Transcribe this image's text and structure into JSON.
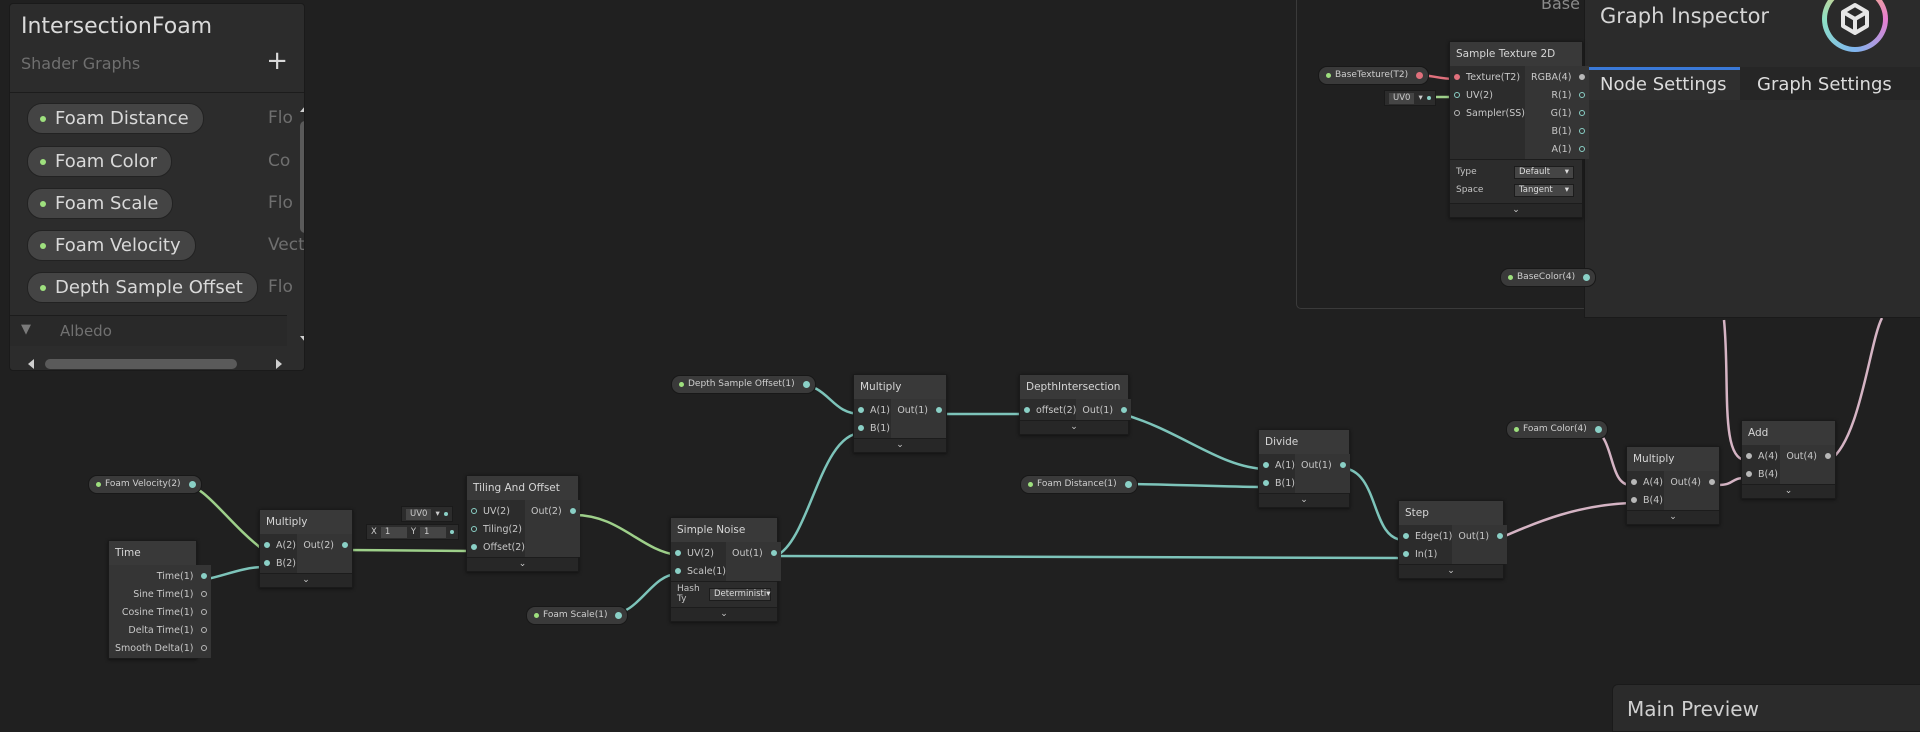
{
  "blackboard": {
    "title": "IntersectionFoam",
    "subtitle": "Shader Graphs",
    "add_label": "+",
    "properties": [
      {
        "name": "Foam Distance",
        "type": "Flo"
      },
      {
        "name": "Foam Color",
        "type": "Co"
      },
      {
        "name": "Foam Scale",
        "type": "Flo"
      },
      {
        "name": "Foam Velocity",
        "type": "Vecto"
      },
      {
        "name": "Depth Sample Offset",
        "type": "Flo"
      }
    ],
    "category": "Albedo",
    "collapse_glyph": "▼"
  },
  "inspector": {
    "title": "Graph Inspector",
    "tabs": [
      "Node Settings",
      "Graph Settings"
    ],
    "active_tab": "Node Settings"
  },
  "main_preview": {
    "title": "Main Preview"
  },
  "base_partial": "Base",
  "nodes": {
    "time": {
      "title": "Time",
      "outputs": [
        "Time(1)",
        "Sine Time(1)",
        "Cosine Time(1)",
        "Delta Time(1)",
        "Smooth Delta(1)"
      ]
    },
    "multiply1": {
      "title": "Multiply",
      "inputs": [
        "A(2)",
        "B(2)"
      ],
      "output": "Out(2)"
    },
    "tiling": {
      "title": "Tiling And Offset",
      "inputs": [
        "UV(2)",
        "Tiling(2)",
        "Offset(2)"
      ],
      "output": "Out(2)"
    },
    "noise": {
      "title": "Simple Noise",
      "inputs": [
        "UV(2)",
        "Scale(1)"
      ],
      "output": "Out(1)",
      "field_label": "Hash Ty",
      "field_value": "Deterministi"
    },
    "multiply2": {
      "title": "Multiply",
      "inputs": [
        "A(1)",
        "B(1)"
      ],
      "output": "Out(1)"
    },
    "depth": {
      "title": "DepthIntersection",
      "inputs": [
        "offset(2)"
      ],
      "output": "Out(1)"
    },
    "divide": {
      "title": "Divide",
      "inputs": [
        "A(1)",
        "B(1)"
      ],
      "output": "Out(1)"
    },
    "step": {
      "title": "Step",
      "inputs": [
        "Edge(1)",
        "In(1)"
      ],
      "output": "Out(1)"
    },
    "multiply3": {
      "title": "Multiply",
      "inputs": [
        "A(4)",
        "B(4)"
      ],
      "output": "Out(4)"
    },
    "add": {
      "title": "Add",
      "inputs": [
        "A(4)",
        "B(4)"
      ],
      "output": "Out(4)"
    },
    "sample": {
      "title": "Sample Texture 2D",
      "inputs": [
        "Texture(T2)",
        "UV(2)",
        "Sampler(SS)"
      ],
      "outputs": [
        "RGBA(4)",
        "R(1)",
        "G(1)",
        "B(1)",
        "A(1)"
      ],
      "type_label": "Type",
      "type_value": "Default",
      "space_label": "Space",
      "space_value": "Tangent"
    }
  },
  "pills": {
    "foam_velocity": "Foam Velocity(2)",
    "foam_scale": "Foam Scale(1)",
    "depth_offset": "Depth Sample Offset(1)",
    "foam_distance": "Foam Distance(1)",
    "foam_color": "Foam Color(4)",
    "base_texture": "BaseTexture(T2)",
    "base_color": "BaseColor(4)"
  },
  "inline": {
    "uv_channel": "UV0",
    "tiling_x_label": "X",
    "tiling_x": "1",
    "tiling_y_label": "Y",
    "tiling_y": "1",
    "sample_uv": "UV0"
  },
  "glyphs": {
    "expand": "⌄",
    "dropdown": "▾"
  },
  "colors": {
    "wire_float": "#7dc4ba",
    "wire_vec2": "#9ed08a",
    "wire_vec4": "#d5b4c4",
    "accent_tab": "#3a79d8"
  }
}
